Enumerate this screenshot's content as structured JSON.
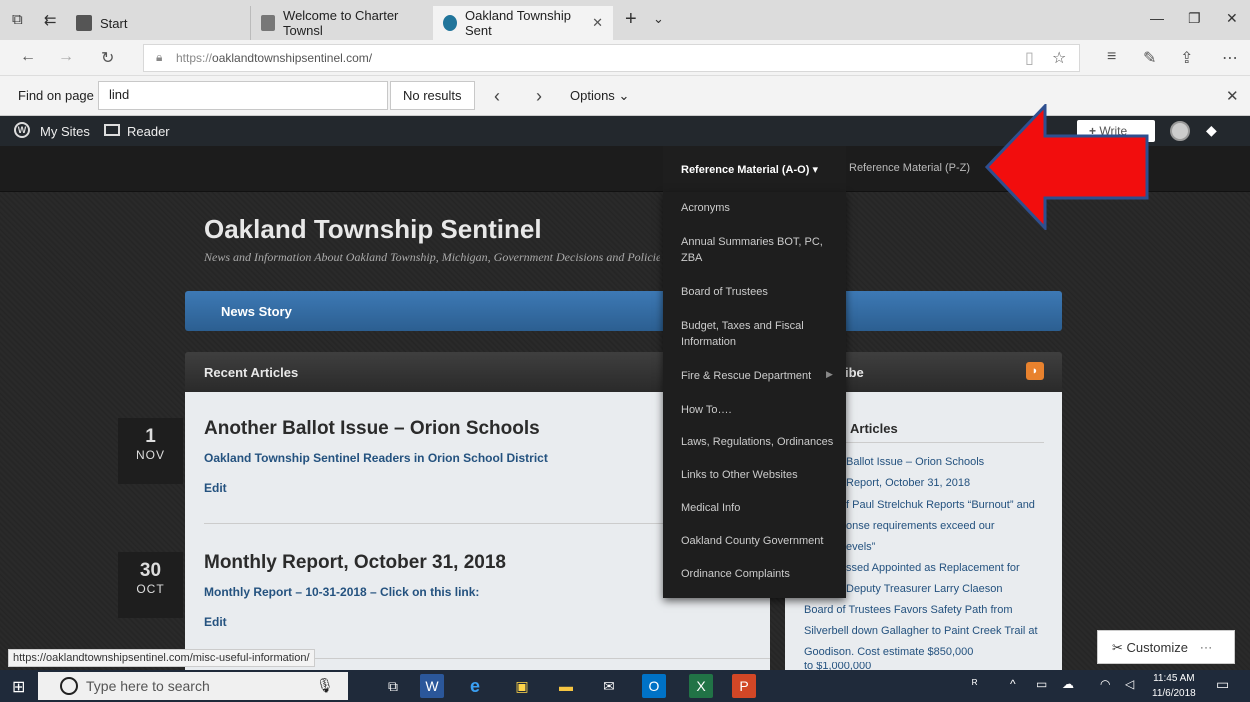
{
  "browser": {
    "tabs": [
      {
        "label": "Start"
      },
      {
        "label": "Welcome to Charter Townsl"
      },
      {
        "label": "Oakland Township Sent"
      }
    ],
    "url_prefix": "https://",
    "url_domain": "oaklandtownshipsentinel.com/",
    "find": {
      "label": "Find on page",
      "value": "lind",
      "results": "No results",
      "options": "Options"
    }
  },
  "wpbar": {
    "my_sites": "My Sites",
    "reader": "Reader",
    "write": "Write"
  },
  "site": {
    "title": "Oakland Township Sentinel",
    "tagline": "News and Information About Oakland Township, Michigan, Government Decisions and Policies",
    "menu_a": "Reference Material (A-O)",
    "menu_b": "Reference Material (P-Z)",
    "news_story": "News Story",
    "recent_head": "Recent Articles",
    "subscribe_head": "ibe",
    "dropdown": [
      "Acronyms",
      "Annual Summaries BOT, PC, ZBA",
      "Board of Trustees",
      "Budget, Taxes and Fiscal Information",
      "Fire & Rescue Department",
      "How To….",
      "Laws, Regulations, Ordinances",
      "Links to Other Websites",
      "Medical Info",
      "Oakland County Government",
      "Ordinance Complaints"
    ],
    "articles": [
      {
        "day": "1",
        "month": "NOV",
        "title": "Another Ballot Issue – Orion Schools",
        "link": "Oakland Township Sentinel Readers in Orion School District",
        "edit": "Edit"
      },
      {
        "day": "30",
        "month": "OCT",
        "title": "Monthly Report, October 31, 2018",
        "link": "Monthly Report – 10-31-2018 – Click on this link:",
        "edit": "Edit"
      }
    ],
    "sidebar_head": "Articles",
    "sidebar_lines": [
      "Ballot Issue – Orion Schools",
      "Report, October 31, 2018",
      "f Paul Strelchuk Reports “Burnout” and",
      "onse requirements exceed our",
      "evels”",
      "ssed Appointed as Replacement for",
      "Deputy Treasurer Larry Claeson",
      "Board of Trustees Favors Safety Path from",
      "Silverbell down Gallagher to Paint Creek Trail at",
      "Goodison. Cost estimate $850,000",
      "to $1,000,000"
    ]
  },
  "status_url": "https://oaklandtownshipsentinel.com/misc-useful-information/",
  "customize": "Customize",
  "taskbar": {
    "search_placeholder": "Type here to search",
    "time": "11:45 AM",
    "date": "11/6/2018"
  }
}
